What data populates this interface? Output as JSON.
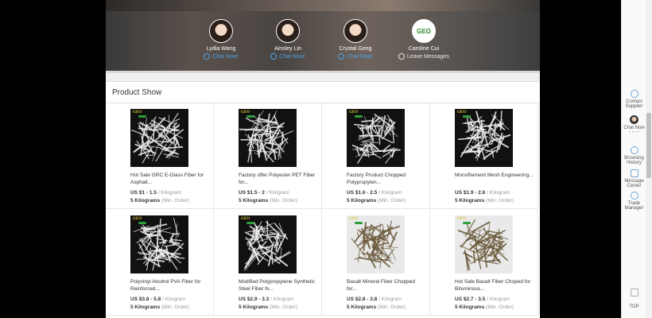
{
  "contacts": [
    {
      "name": "Lydia Wang",
      "action": "Chat Now!"
    },
    {
      "name": "Ainsley Lin",
      "action": "Chat Now!"
    },
    {
      "name": "Crystal Geng",
      "action": "Chat Now!"
    },
    {
      "name": "Caroline Cui",
      "action": "Leave Messages"
    }
  ],
  "section": {
    "title": "Product Show"
  },
  "products": [
    {
      "name": "Hot Sale GRC E-Glass Fiber for Asphalt...",
      "price": "US $1 - 1.5",
      "unit": " / Kilogram",
      "moq": "5 Kilograms",
      "moq_note": " (Min. Order)",
      "icon": "white-fiber-image"
    },
    {
      "name": "Factory offer Polyester PET Fiber for...",
      "price": "US $1.5 - 2",
      "unit": " / Kilogram",
      "moq": "5 Kilograms",
      "moq_note": " (Min. Order)",
      "icon": "white-fiber-image"
    },
    {
      "name": "Factory Product Chopped Polypropylen...",
      "price": "US $1.6 - 2.5",
      "unit": " / Kilogram",
      "moq": "5 Kilograms",
      "moq_note": " (Min. Order)",
      "icon": "white-fiber-image"
    },
    {
      "name": "Monofilament Mesh Engineering...",
      "price": "US $1.9 - 2.6",
      "unit": " / Kilogram",
      "moq": "5 Kilograms",
      "moq_note": " (Min. Order)",
      "icon": "white-fiber-image"
    },
    {
      "name": "Polyvinyl Alcohol PVA Fiber for Reinforced...",
      "price": "US $3.8 - 5.8",
      "unit": " / Kilogram",
      "moq": "5 Kilograms",
      "moq_note": " (Min. Order)",
      "icon": "white-fiber-image"
    },
    {
      "name": "Modified Polypropylene Synthetic Steel Fiber fo...",
      "price": "US $2.9 - 3.3",
      "unit": " / Kilogram",
      "moq": "5 Kilograms",
      "moq_note": " (Min. Order)",
      "icon": "white-fiber-image"
    },
    {
      "name": "Basalt Mineral Fiber Chopped for...",
      "price": "US $2.8 - 3.8",
      "unit": " / Kilogram",
      "moq": "5 Kilograms",
      "moq_note": " (Min. Order)",
      "icon": "dark-fiber-image"
    },
    {
      "name": "Hot Sale Basalt Fiber Choped for Bituminous...",
      "price": "US $2.7 - 3.5",
      "unit": " / Kilogram",
      "moq": "5 Kilograms",
      "moq_note": " (Min. Order)",
      "icon": "dark-fiber-image"
    }
  ],
  "thumb_brand": "GEO",
  "sidebar": {
    "contact": "Contact Supplier",
    "chat": "Chat Now",
    "dots": "• • • •",
    "browsing": "Browsing History",
    "message": "Message Center",
    "trade": "Trade Manager",
    "top": "TOP"
  },
  "colors": {
    "link": "#4aa3e6",
    "dark_fiber": "#6b5a3c",
    "white_fiber": "#eeeeee"
  }
}
